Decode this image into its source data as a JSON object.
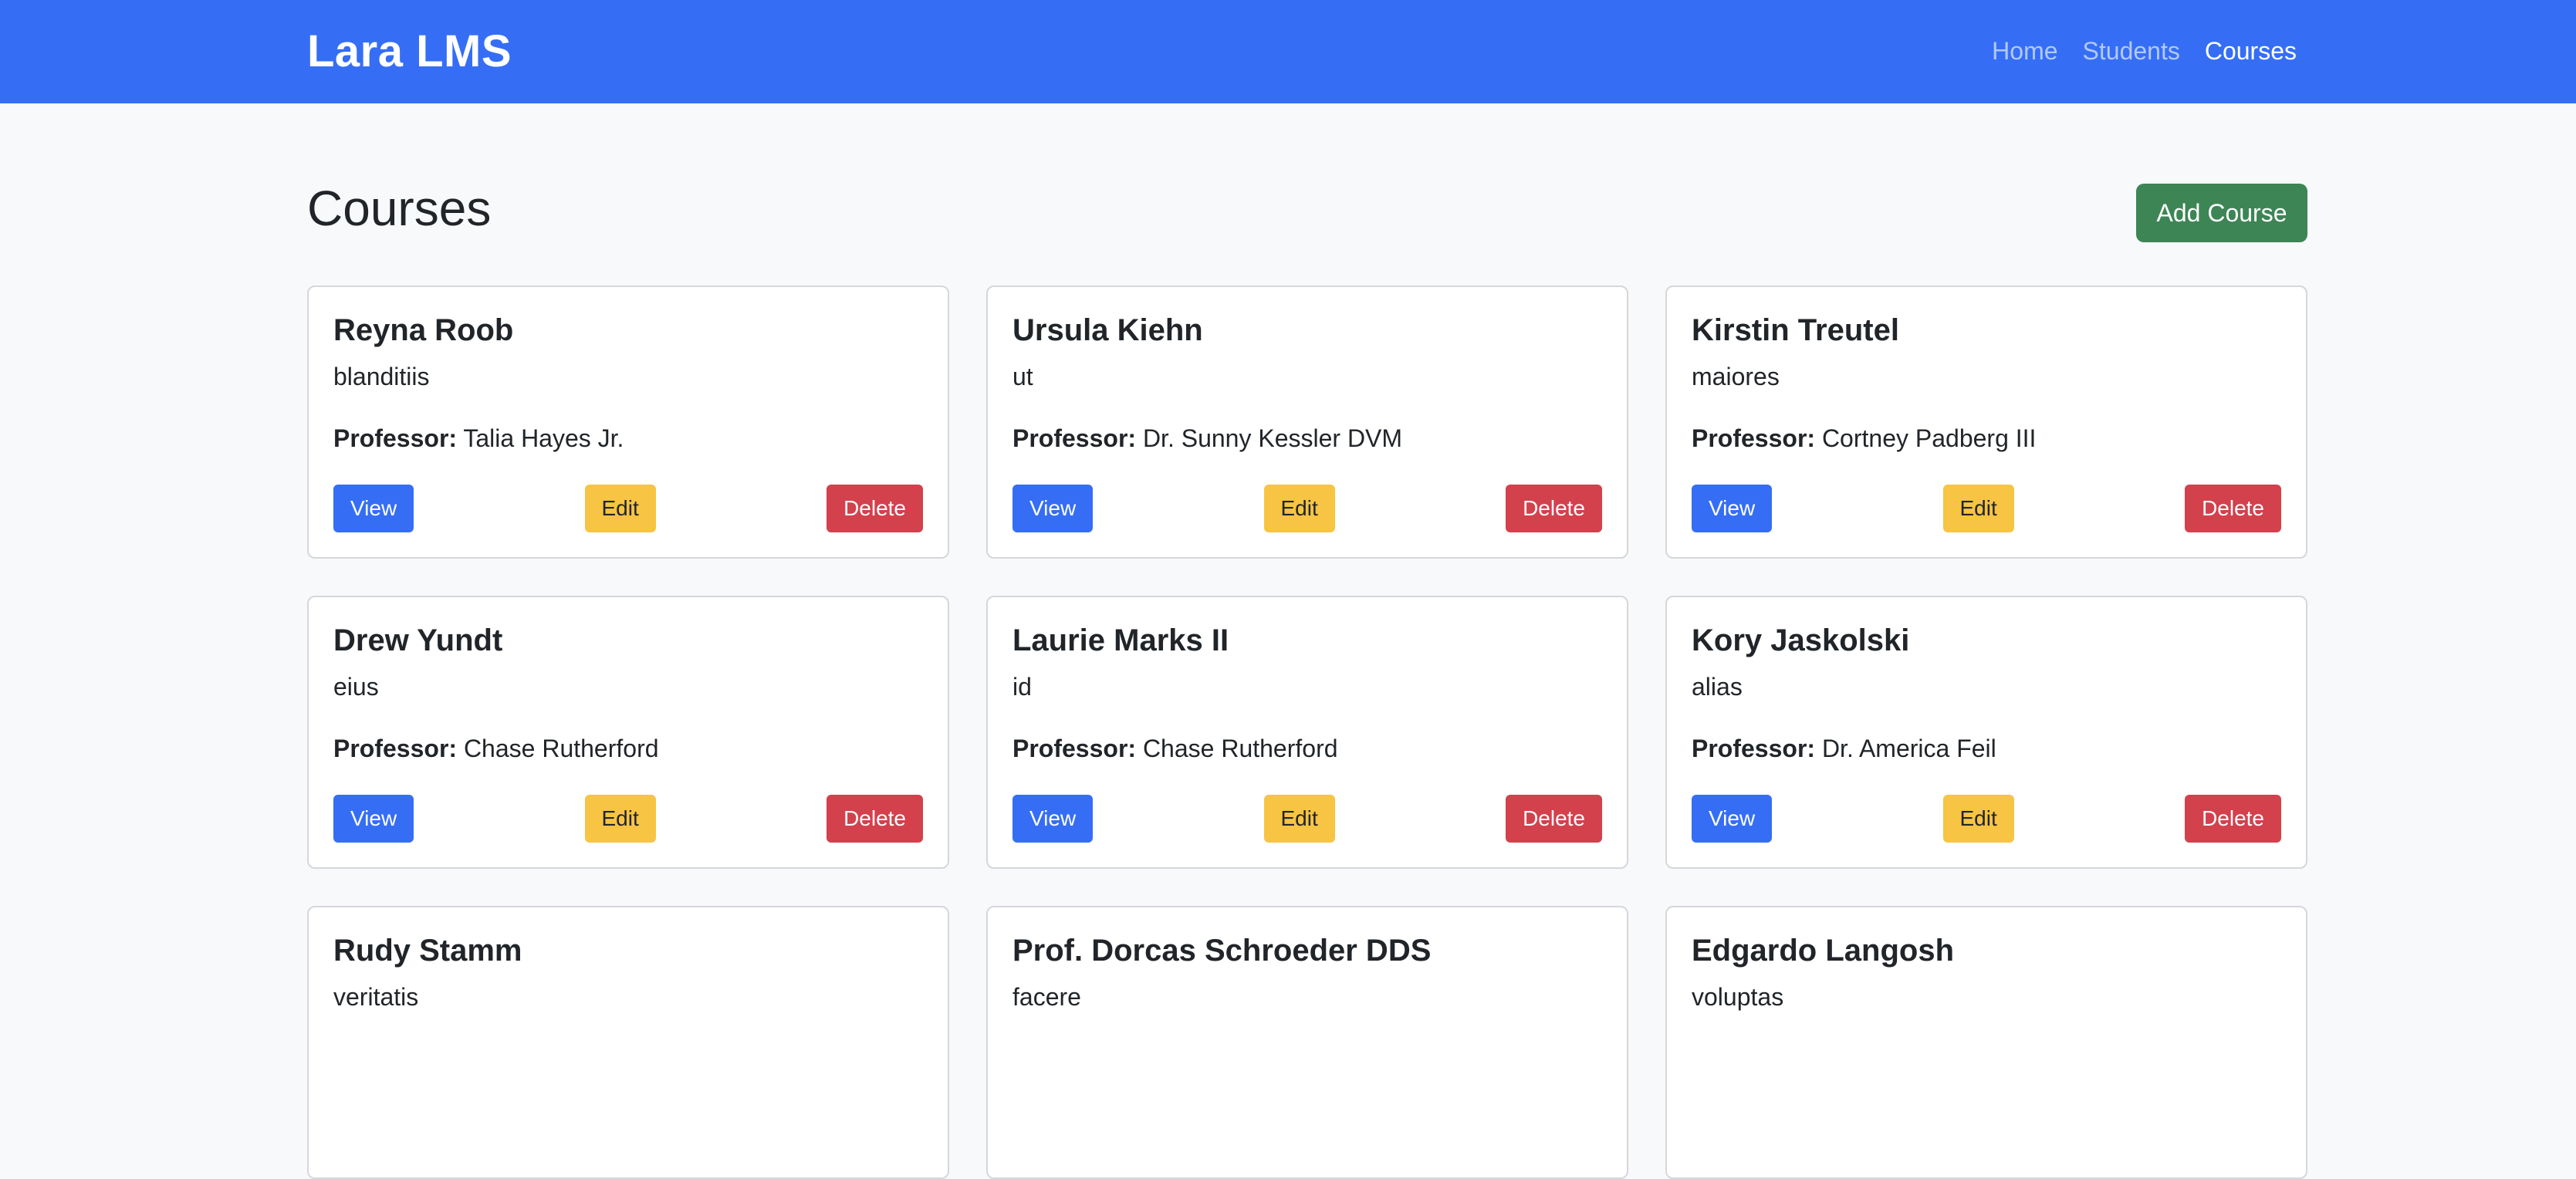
{
  "navbar": {
    "brand": "Lara LMS",
    "links": [
      {
        "label": "Home",
        "active": false
      },
      {
        "label": "Students",
        "active": false
      },
      {
        "label": "Courses",
        "active": true
      }
    ],
    "color": "#356ef5"
  },
  "page": {
    "title": "Courses",
    "add_button": "Add Course"
  },
  "labels": {
    "professor": "Professor:",
    "view": "View",
    "edit": "Edit",
    "delete": "Delete"
  },
  "courses": [
    {
      "name": "Reyna Roob",
      "code": "blanditiis",
      "professor": "Talia Hayes Jr."
    },
    {
      "name": "Ursula Kiehn",
      "code": "ut",
      "professor": "Dr. Sunny Kessler DVM"
    },
    {
      "name": "Kirstin Treutel",
      "code": "maiores",
      "professor": "Cortney Padberg III"
    },
    {
      "name": "Drew Yundt",
      "code": "eius",
      "professor": "Chase Rutherford"
    },
    {
      "name": "Laurie Marks II",
      "code": "id",
      "professor": "Chase Rutherford"
    },
    {
      "name": "Kory Jaskolski",
      "code": "alias",
      "professor": "Dr. America Feil"
    },
    {
      "name": "Rudy Stamm",
      "code": "veritatis",
      "professor": ""
    },
    {
      "name": "Prof. Dorcas Schroeder DDS",
      "code": "facere",
      "professor": ""
    },
    {
      "name": "Edgardo Langosh",
      "code": "voluptas",
      "professor": ""
    }
  ],
  "colors": {
    "view": "#356ef5",
    "edit": "#f7c443",
    "delete": "#d2414c",
    "add": "#3d8555"
  }
}
